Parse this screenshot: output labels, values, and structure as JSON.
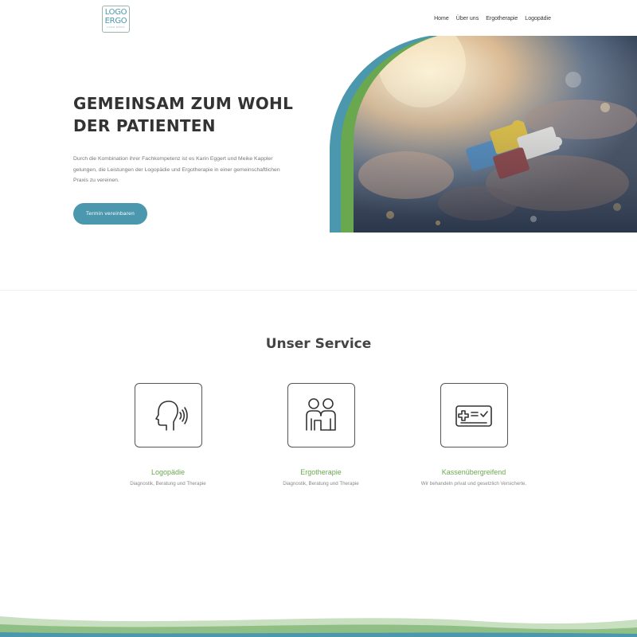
{
  "header": {
    "logo": {
      "line1": "LOGO",
      "line2": "ERGO",
      "tagline": "LOGO ERGO"
    },
    "nav": [
      "Home",
      "Über uns",
      "Ergotherapie",
      "Logopädie"
    ]
  },
  "hero": {
    "title": "GEMEINSAM ZUM WOHL DER PATIENTEN",
    "text": "Durch die Kombination ihrer Fachkompetenz ist es Karin Eggert und Meike Kappler gelungen, die Leistungen der Logopädie und Ergotherapie in einer gemeinschaftlichen Praxis zu vereinen.",
    "cta_label": "Termin vereinbaren",
    "image_icon": "puzzle-hands-photo"
  },
  "services": {
    "title": "Unser Service",
    "items": [
      {
        "title": "Logopädie",
        "description": "Diagnostik, Beratung und Therapie",
        "icon": "speaking-head-icon"
      },
      {
        "title": "Ergotherapie",
        "description": "Diagnostik, Beratung und Therapie",
        "icon": "two-people-icon"
      },
      {
        "title": "Kassenübergreifend",
        "description": "Wir behandeln privat und gesetzlich Versicherte.",
        "icon": "insurance-card-icon"
      }
    ]
  },
  "colors": {
    "accent_teal": "#4b97ad",
    "accent_green": "#6aa84f",
    "text_dark": "#333333",
    "text_muted": "#777777"
  }
}
